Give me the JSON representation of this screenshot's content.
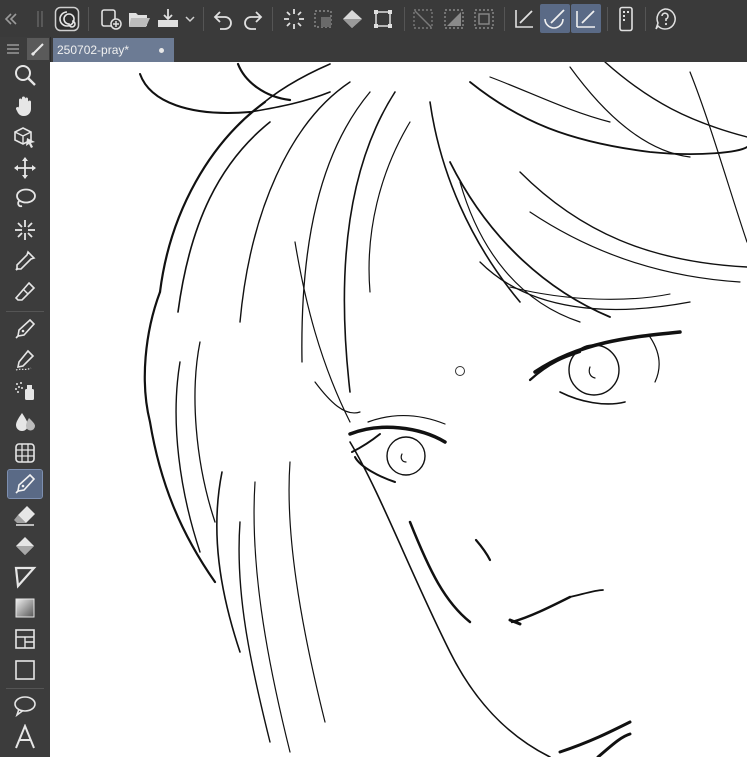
{
  "document_tab": {
    "title": "250702-pray*"
  },
  "accent_color": "#5a6a86",
  "toolbar": {
    "items": [
      "collapse-panels-icon",
      "grip-icon",
      "clip-studio-logo-icon",
      "new-canvas-icon",
      "open-icon",
      "save-icon",
      "dropdown-chevron-icon",
      "undo-icon",
      "redo-icon",
      "deselect-icon",
      "clear-icon",
      "fill-icon",
      "transform-icon",
      "hide-selection-icon",
      "select-all-icon",
      "crop-icon",
      "ruler-snap-icon",
      "special-ruler-snap-icon",
      "grid-snap-icon",
      "smartphone-icon",
      "help-icon"
    ],
    "active": [
      "special-ruler-snap-icon",
      "grid-snap-icon"
    ]
  },
  "tools": {
    "items": [
      "zoom-icon",
      "hand-icon",
      "operation-icon",
      "move-layer-icon",
      "lasso-selection-icon",
      "auto-select-icon",
      "eyedropper-icon",
      "eraser-sub-icon",
      "pen-icon",
      "pencil-icon",
      "airbrush-icon",
      "blend-icon",
      "frame-icon",
      "g-pen-icon",
      "eraser-icon",
      "fill-bucket-icon",
      "figure-icon",
      "gradient-icon",
      "frame-border-icon",
      "rectangle-icon",
      "balloon-icon",
      "text-icon"
    ],
    "active": "g-pen-icon"
  }
}
